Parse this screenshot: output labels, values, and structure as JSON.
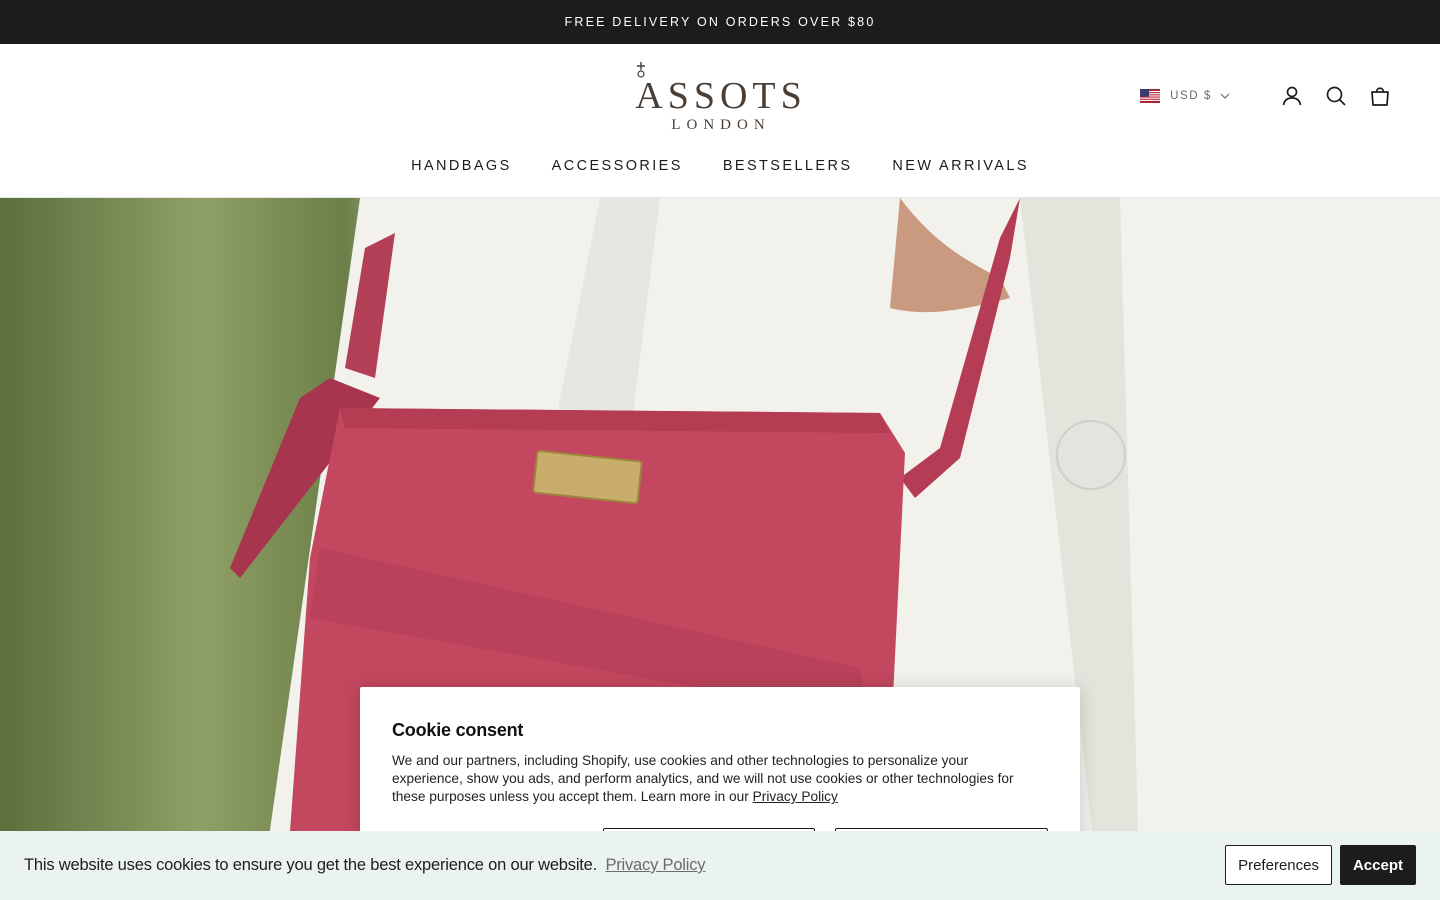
{
  "announcement": {
    "text": "FREE DELIVERY ON ORDERS OVER $80"
  },
  "header": {
    "logo_text": "ASSOTS",
    "logo_subtext": "LONDON",
    "currency": "USD $",
    "icons": {
      "account": "account-icon",
      "search": "search-icon",
      "cart": "cart-icon",
      "flag": "us-flag-icon"
    }
  },
  "nav": {
    "items": [
      {
        "label": "HANDBAGS"
      },
      {
        "label": "ACCESSORIES"
      },
      {
        "label": "BESTSELLERS"
      },
      {
        "label": "NEW ARRIVALS"
      }
    ]
  },
  "cookie_modal": {
    "title": "Cookie consent",
    "body": "We and our partners, including Shopify, use cookies and other technologies to personalize your experience, show you ads, and perform analytics, and we will not use cookies or other technologies for these purposes unless you accept them. Learn more in our",
    "link": "Privacy Policy"
  },
  "cookie_banner": {
    "text": "This website uses cookies to ensure you get the best experience on our website.",
    "link": "Privacy Policy",
    "preferences_label": "Preferences",
    "accept_label": "Accept"
  },
  "colors": {
    "dark": "#1c1c1c",
    "banner_bg": "#eaf3f1",
    "bag": "#c3475e",
    "logo": "#4a3f36"
  }
}
